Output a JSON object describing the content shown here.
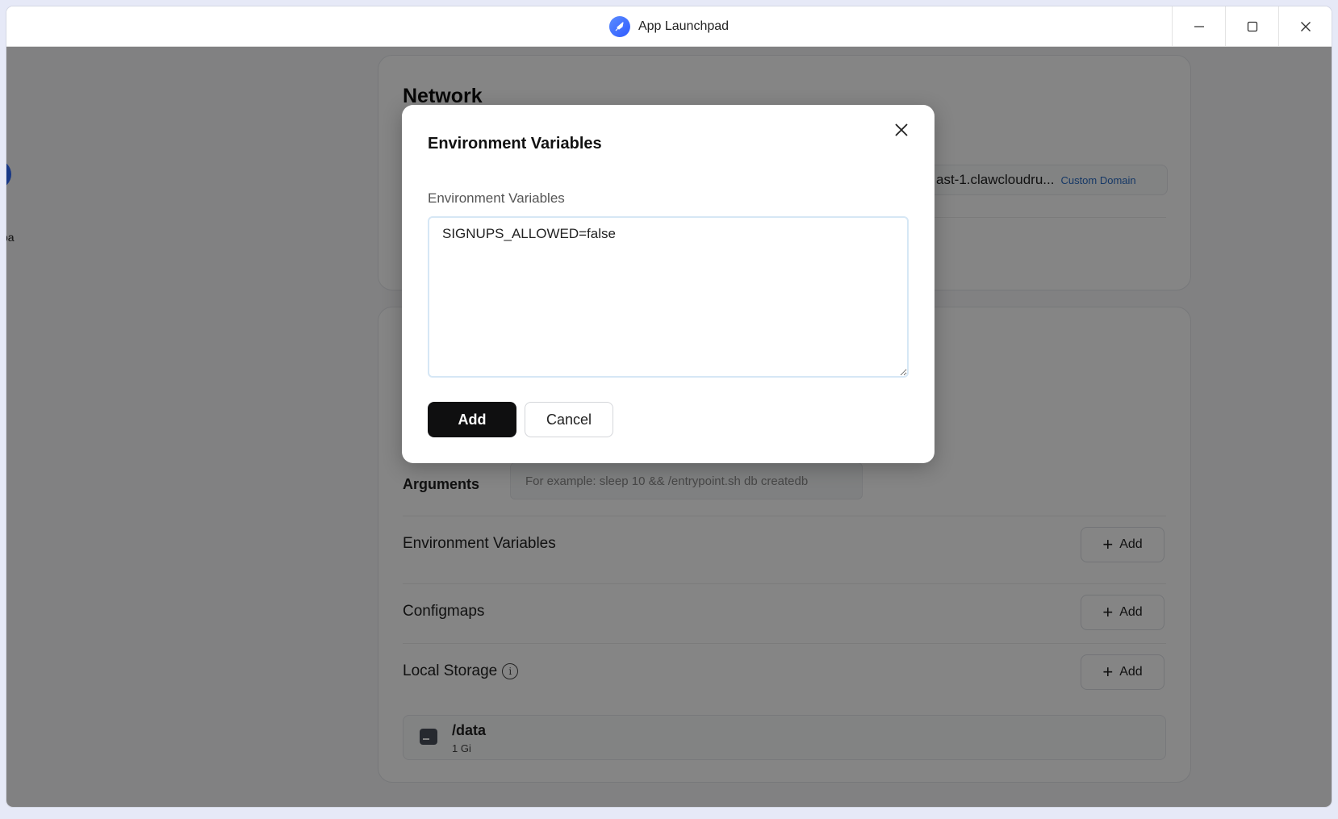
{
  "window": {
    "title": "App Launchpad",
    "controls": [
      "minimize-icon",
      "maximize-icon",
      "close-icon"
    ]
  },
  "sidebar": {
    "partial_text": "pa"
  },
  "network": {
    "heading": "Network",
    "domain_text": "ast-1.clawcloudru...",
    "custom_domain_label": "Custom Domain"
  },
  "advanced": {
    "arguments_label": "Arguments",
    "arguments_placeholder": "For example:  sleep 10 && /entrypoint.sh db createdb",
    "env_vars_label": "Environment Variables",
    "configmaps_label": "Configmaps",
    "local_storage_label": "Local Storage",
    "add_label": "Add",
    "storage": [
      {
        "path": "/data",
        "size": "1 Gi"
      }
    ]
  },
  "modal": {
    "title": "Environment Variables",
    "field_label": "Environment Variables",
    "textarea_value": "SIGNUPS_ALLOWED=false",
    "add_label": "Add",
    "cancel_label": "Cancel"
  },
  "colors": {
    "accent_logo": "#2f5bff",
    "primary_button": "#0f0f10",
    "link": "#2b6cc4",
    "overlay": "rgba(0,0,0,0.48)"
  }
}
